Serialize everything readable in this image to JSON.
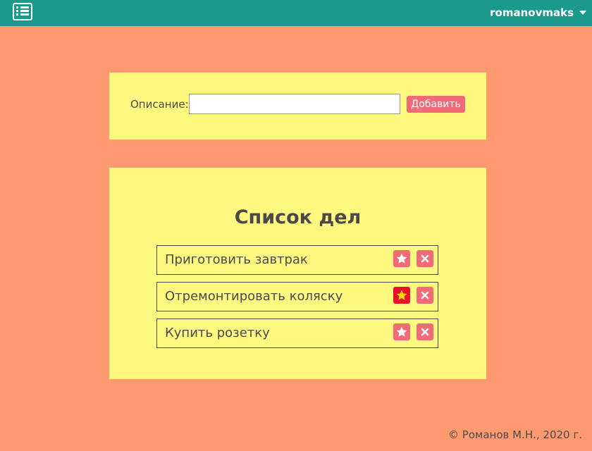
{
  "header": {
    "username": "romanovmaks",
    "menu_icon": "list-icon",
    "caret_icon": "caret-down-icon"
  },
  "form": {
    "label": "Описание:",
    "input_value": "",
    "add_button_label": "Добавить"
  },
  "list": {
    "title": "Список дел",
    "items": [
      {
        "text": "Приготовить завтрак",
        "starred": false
      },
      {
        "text": "Отремонтировать коляску",
        "starred": true
      },
      {
        "text": "Купить розетку",
        "starred": false
      }
    ]
  },
  "footer": {
    "copyright": "© Романов М.Н., 2020 г."
  },
  "colors": {
    "background": "#ff9a70",
    "topbar": "#1a9a8a",
    "panel": "#fffa7f",
    "button": "#f06a78",
    "star_active_bg": "#e8102c",
    "star_active": "#ffd700"
  }
}
